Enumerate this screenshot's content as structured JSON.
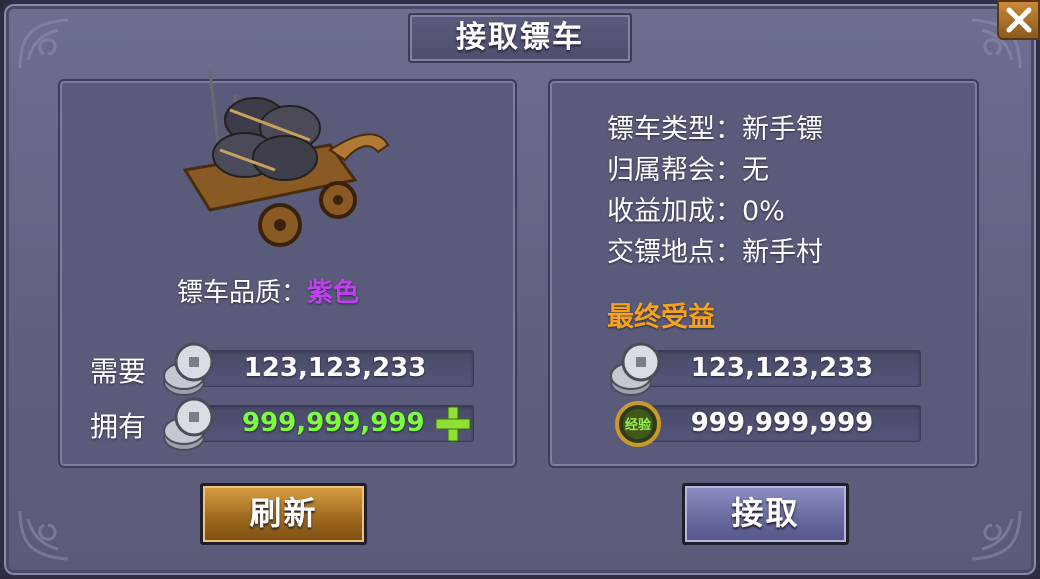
{
  "window": {
    "title": "接取镖车"
  },
  "cart": {
    "quality_label": "镖车品质：",
    "quality_value": "紫色",
    "quality_color": "#c040f0"
  },
  "cost": {
    "need_label": "需要",
    "need_value": "123,123,233",
    "have_label": "拥有",
    "have_value": "999,999,999",
    "coin_icon": "silver-coin-icon",
    "add_icon": "plus-icon"
  },
  "info": {
    "lines": [
      "镖车类型：新手镖",
      "归属帮会：无",
      "收益加成：0%",
      "交镖地点：新手村"
    ],
    "final_label": "最终受益",
    "final_label_color": "#f7a21a",
    "reward_money": "123,123,233",
    "reward_exp": "999,999,999",
    "exp_icon_text": "经验"
  },
  "buttons": {
    "refresh": "刷新",
    "accept": "接取"
  }
}
